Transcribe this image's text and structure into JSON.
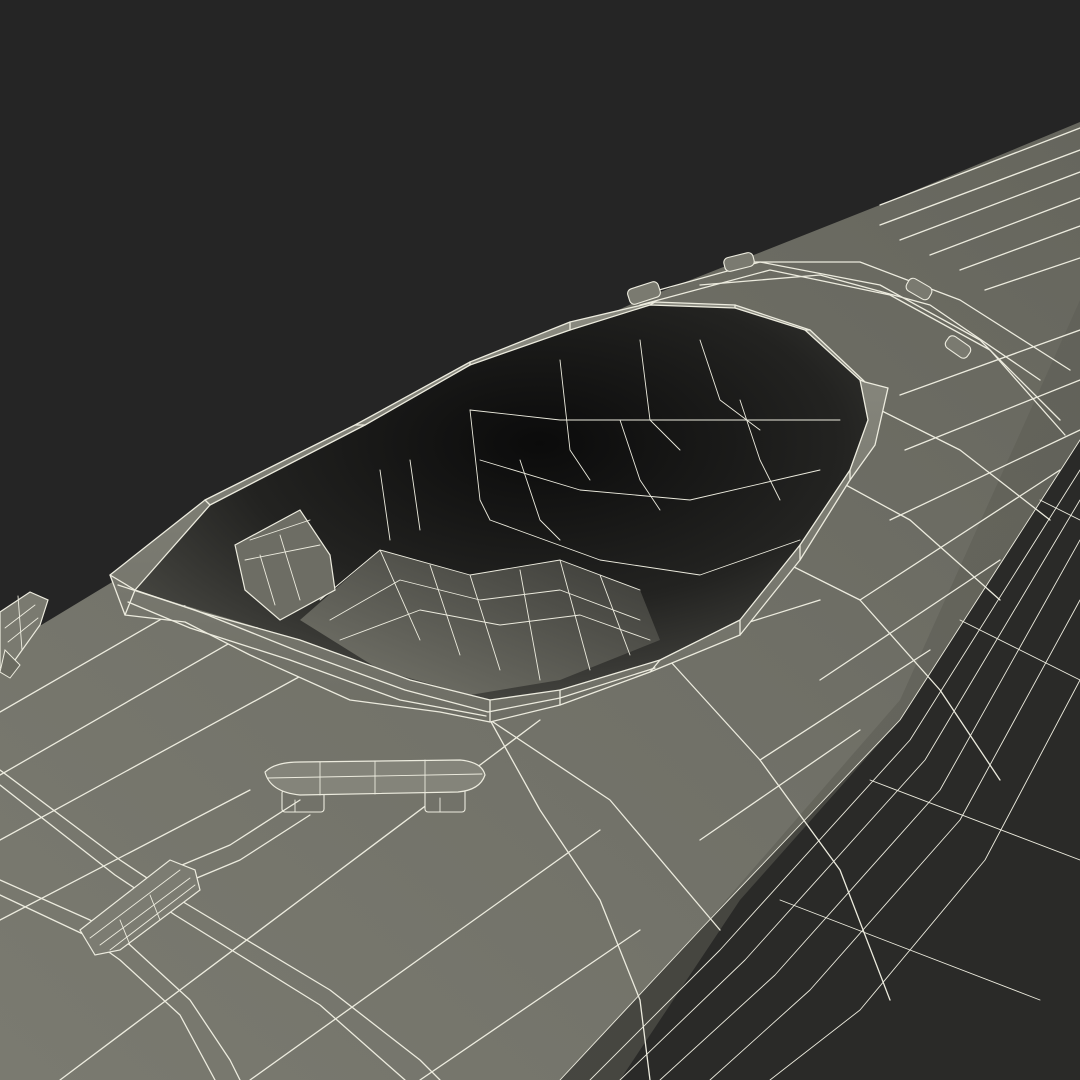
{
  "scene": {
    "subject": "kayak-wireframe-render",
    "colors": {
      "background": "#252525",
      "hull_light": "#7d7d72",
      "hull_mid": "#6b6b61",
      "hull_dark": "#55554d",
      "cockpit_deep": "#0d0d0d",
      "wire": "#ecebde"
    },
    "icons": [
      "deck-handle",
      "deck-fitting",
      "bungee-cord",
      "cockpit-rim",
      "seat-backrest"
    ]
  }
}
